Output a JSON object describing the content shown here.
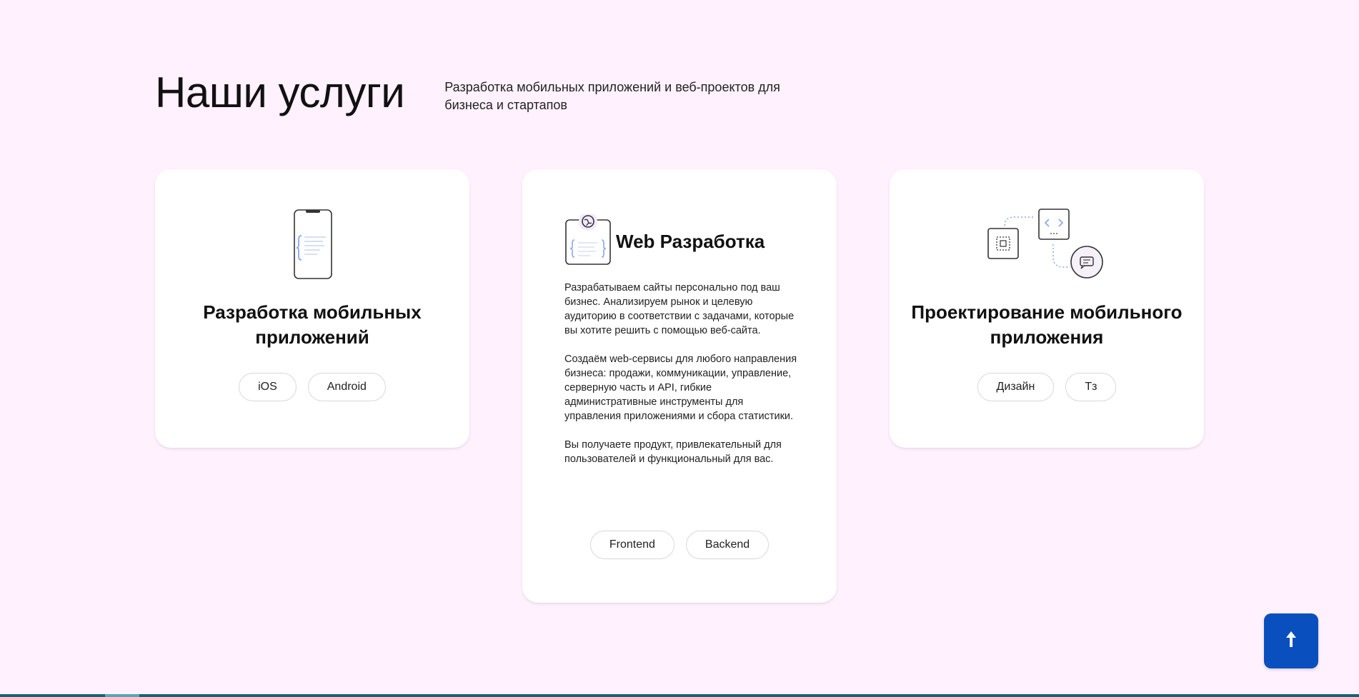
{
  "header": {
    "title": "Наши услуги",
    "subtitle": "Разработка мобильных приложений и веб-проектов для бизнеса и стартапов"
  },
  "cards": [
    {
      "title": "Разработка мобильных приложений",
      "icon": "phone-code-icon",
      "chips": [
        "iOS",
        "Android"
      ]
    },
    {
      "title": "Web Разработка",
      "icon": "browser-code-icon",
      "paragraphs": [
        "Разрабатываем сайты персонально под ваш бизнес. Анализируем рынок и целевую аудиторию в соответствии с задачами, которые вы хотите решить с помощью веб-сайта.",
        "Создаём web-сервисы для любого направления бизнеса: продажи, коммуникации, управление, серверную часть и API, гибкие административные инструменты для управления приложениями и сбора статистики.",
        "Вы получаете продукт, привлекательный для пользователей и функциональный для вас."
      ],
      "chips": [
        "Frontend",
        "Backend"
      ]
    },
    {
      "title": "Проектирование мобильного приложения",
      "icon": "prototype-flow-icon",
      "chips": [
        "Дизайн",
        "Тз"
      ]
    }
  ],
  "scroll_top": {
    "icon": "arrow-up-icon"
  },
  "colors": {
    "background": "#fff1fd",
    "accent": "#0a4fbe",
    "icon_blue": "#8aa6e8",
    "icon_purple": "#b7a6f0"
  }
}
